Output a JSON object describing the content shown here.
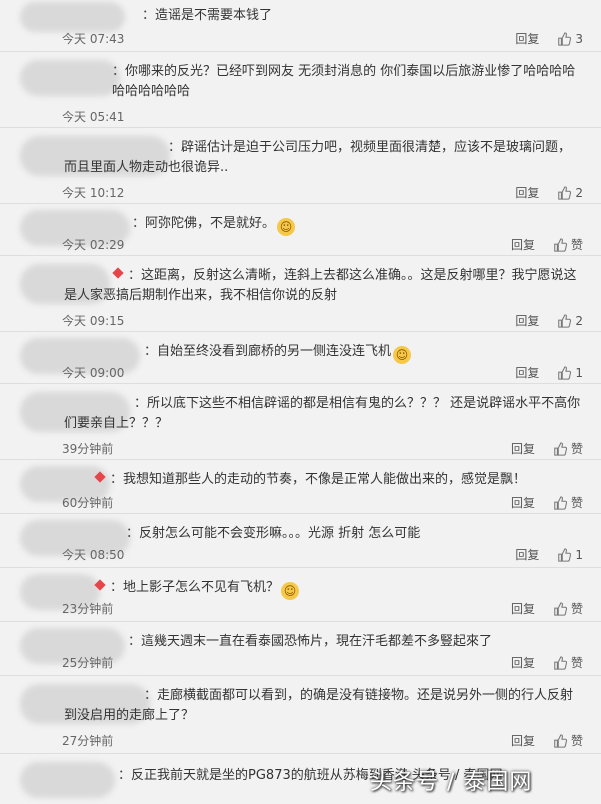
{
  "comments": [
    {
      "text": "造谣是不需要本钱了",
      "time": "今天 07:43",
      "reply": "回复",
      "likes": "3"
    },
    {
      "text": "你哪来的反光？已经吓到网友 无须封消息的 你们泰国以后旅游业惨了哈哈哈哈哈哈哈哈哈哈",
      "time": "今天 05:41",
      "reply": "回复",
      "likes": ""
    },
    {
      "text": "辟谣估计是迫于公司压力吧，视频里面很清楚，应该不是玻璃问题，而且里面人物走动也很诡异..",
      "time": "今天 10:12",
      "reply": "回复",
      "likes": "2"
    },
    {
      "text": "阿弥陀佛，不是就好。",
      "time": "今天 02:29",
      "reply": "回复",
      "likes": "赞"
    },
    {
      "text": "这距离，反射这么清晰，连斜上去都这么准确。。这是反射哪里？我宁愿说这是人家恶搞后期制作出来，我不相信你说的反射",
      "time": "今天 09:15",
      "reply": "回复",
      "likes": "2"
    },
    {
      "text": "自始至终没看到廊桥的另一侧连没连飞机",
      "time": "今天 09:00",
      "reply": "回复",
      "likes": "1"
    },
    {
      "text": "所以底下这些不相信辟谣的都是相信有鬼的么？？？ 还是说辟谣水平不高你们要亲自上？？？",
      "time": "39分钟前",
      "reply": "回复",
      "likes": "赞"
    },
    {
      "text": "我想知道那些人的走动的节奏，不像是正常人能做出来的，感觉是飘！",
      "time": "60分钟前",
      "reply": "回复",
      "likes": "赞"
    },
    {
      "text": "反射怎么可能不会变形嘛。。。光源 折射 怎么可能",
      "time": "今天 08:50",
      "reply": "回复",
      "likes": "1"
    },
    {
      "text": "地上影子怎么不见有飞机？",
      "time": "23分钟前",
      "reply": "回复",
      "likes": "赞"
    },
    {
      "text": "這幾天週末一直在看泰國恐怖片，現在汗毛都差不多豎起來了",
      "time": "25分钟前",
      "reply": "回复",
      "likes": "赞"
    },
    {
      "text": "走廊横截面都可以看到，的确是没有链接物。还是说另外一侧的行人反射到没启用的走廊上了？",
      "time": "27分钟前",
      "reply": "回复",
      "likes": "赞"
    },
    {
      "text": "反正我前天就是坐的PG873的航班从苏梅到香港 头条号 / 泰国网",
      "time": "",
      "reply": "",
      "likes": ""
    }
  ],
  "watermark": "头条号 / 泰国网",
  "colors": {
    "background": "#f2f2f2",
    "text": "#333333",
    "meta": "#666666",
    "badge": "#e6454a"
  }
}
